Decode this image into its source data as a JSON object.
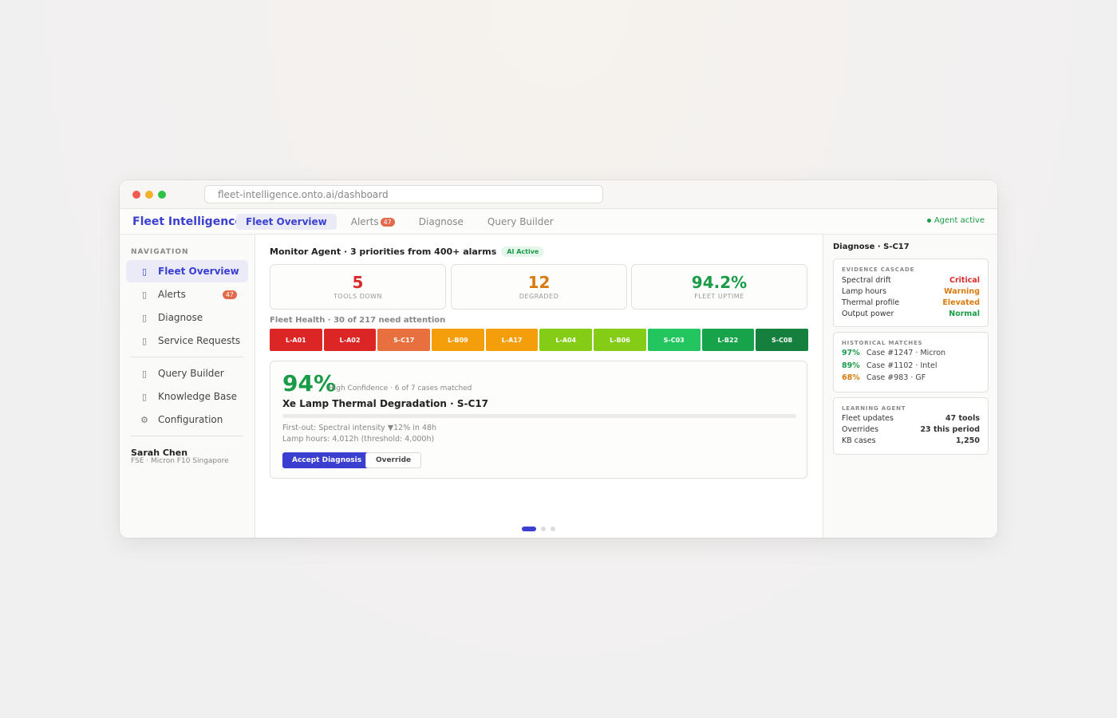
{
  "browser": {
    "url": "fleet-intelligence.onto.ai/dashboard"
  },
  "header": {
    "brand": "Fleet Intelligence",
    "tabs": [
      {
        "label": "Fleet Overview",
        "active": true
      },
      {
        "label": "Alerts",
        "badge": "47"
      },
      {
        "label": "Diagnose"
      },
      {
        "label": "Query Builder"
      }
    ],
    "agent_status": "Agent active"
  },
  "sidebar": {
    "title": "NAVIGATION",
    "items": [
      {
        "label": "Fleet Overview",
        "icon": "grid-icon",
        "glyph": "▯",
        "active": true
      },
      {
        "label": "Alerts",
        "icon": "bell-icon",
        "glyph": "▯",
        "badge": "47"
      },
      {
        "label": "Diagnose",
        "icon": "stethoscope-icon",
        "glyph": "▯"
      },
      {
        "label": "Service Requests",
        "icon": "ticket-icon",
        "glyph": "▯"
      },
      {
        "label": "Query Builder",
        "icon": "query-icon",
        "glyph": "▯"
      },
      {
        "label": "Knowledge Base",
        "icon": "book-icon",
        "glyph": "▯"
      },
      {
        "label": "Configuration",
        "icon": "gear-icon",
        "glyph": "⚙"
      }
    ],
    "user": {
      "name": "Sarah Chen",
      "role": "FSE · Micron F10 Singapore"
    }
  },
  "main": {
    "header": "Monitor Agent · 3 priorities from 400+ alarms",
    "ai_pill": "AI Active",
    "stats": [
      {
        "value": "5",
        "label": "TOOLS DOWN",
        "color": "#d92b2b"
      },
      {
        "value": "12",
        "label": "DEGRADED",
        "color": "#d97a0c"
      },
      {
        "value": "94.2%",
        "label": "FLEET UPTIME",
        "color": "#1a9b48"
      }
    ],
    "health_title": "Fleet Health · 30 of 217 need attention",
    "tools": [
      {
        "id": "L-A01",
        "color": "#dc2626"
      },
      {
        "id": "L-A02",
        "color": "#dc2626"
      },
      {
        "id": "S-C17",
        "color": "#e8703e"
      },
      {
        "id": "L-B09",
        "color": "#f59e0b"
      },
      {
        "id": "L-A17",
        "color": "#f59e0b"
      },
      {
        "id": "L-A04",
        "color": "#84cc16"
      },
      {
        "id": "L-B06",
        "color": "#84cc16"
      },
      {
        "id": "S-C03",
        "color": "#22c55e"
      },
      {
        "id": "L-B22",
        "color": "#16a34a"
      },
      {
        "id": "S-C08",
        "color": "#15803d"
      }
    ],
    "diagnosis": {
      "confidence": "94%",
      "confidence_note": "High Confidence · 6 of 7 cases matched",
      "title": "Xe Lamp Thermal Degradation · S-C17",
      "first_out": "First-out: Spectral intensity ▼12% in 48h",
      "lamp_hours": "Lamp hours: 4,012h (threshold: 4,000h)",
      "accept_label": "Accept Diagnosis",
      "override_label": "Override"
    },
    "pager": {
      "pages": 3,
      "current": 1
    }
  },
  "right_panel": {
    "title": "Diagnose · S-C17",
    "evidence": {
      "title": "EVIDENCE CASCADE",
      "rows": [
        {
          "label": "Spectral drift",
          "value": "Critical",
          "color": "#d92b2b"
        },
        {
          "label": "Lamp hours",
          "value": "Warning",
          "color": "#d97a0c"
        },
        {
          "label": "Thermal profile",
          "value": "Elevated",
          "color": "#d97a0c"
        },
        {
          "label": "Output power",
          "value": "Normal",
          "color": "#1a9b48"
        }
      ]
    },
    "history": {
      "title": "HISTORICAL MATCHES",
      "rows": [
        {
          "pct": "97%",
          "text": "Case #1247 · Micron",
          "color": "#1a9b48"
        },
        {
          "pct": "89%",
          "text": "Case #1102 · Intel",
          "color": "#1a9b48"
        },
        {
          "pct": "68%",
          "text": "Case #983 · GF",
          "color": "#d97a0c"
        }
      ]
    },
    "learning": {
      "title": "LEARNING AGENT",
      "rows": [
        {
          "label": "Fleet updates",
          "value": "47 tools"
        },
        {
          "label": "Overrides",
          "value": "23 this period"
        },
        {
          "label": "KB cases",
          "value": "1,250"
        }
      ]
    }
  }
}
